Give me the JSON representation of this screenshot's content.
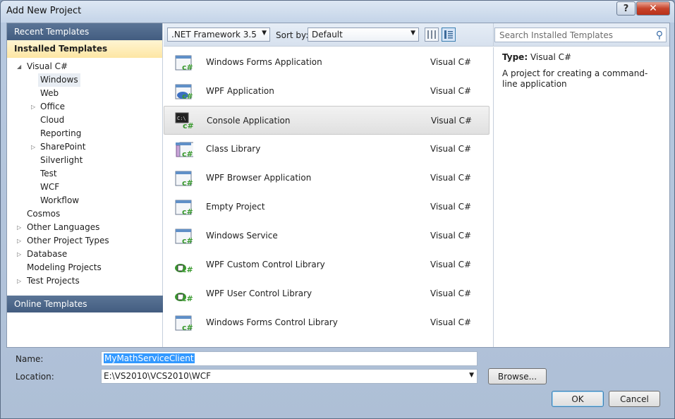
{
  "window": {
    "title": "Add New Project",
    "help": "?",
    "close": "✕"
  },
  "sidebar": {
    "recent": "Recent Templates",
    "installed": "Installed Templates",
    "online": "Online Templates",
    "tree": [
      {
        "label": "Visual C#",
        "arrow": "◢"
      },
      {
        "label": "Windows"
      },
      {
        "label": "Web"
      },
      {
        "label": "Office",
        "arrow": "▷"
      },
      {
        "label": "Cloud"
      },
      {
        "label": "Reporting"
      },
      {
        "label": "SharePoint",
        "arrow": "▷"
      },
      {
        "label": "Silverlight"
      },
      {
        "label": "Test"
      },
      {
        "label": "WCF"
      },
      {
        "label": "Workflow"
      },
      {
        "label": "Cosmos"
      },
      {
        "label": "Other Languages",
        "arrow": "▷"
      },
      {
        "label": "Other Project Types",
        "arrow": "▷"
      },
      {
        "label": "Database",
        "arrow": "▷"
      },
      {
        "label": "Modeling Projects"
      },
      {
        "label": "Test Projects",
        "arrow": "▷"
      }
    ]
  },
  "toolbar": {
    "framework": ".NET Framework 3.5",
    "sort_label": "Sort by:",
    "sort_value": "Default"
  },
  "search": {
    "placeholder": "Search Installed Templates"
  },
  "templates": [
    {
      "name": "Windows Forms Application",
      "lang": "Visual C#",
      "icon": "winforms-app-icon"
    },
    {
      "name": "WPF Application",
      "lang": "Visual C#",
      "icon": "wpf-app-icon"
    },
    {
      "name": "Console Application",
      "lang": "Visual C#",
      "icon": "console-app-icon"
    },
    {
      "name": "Class Library",
      "lang": "Visual C#",
      "icon": "class-library-icon"
    },
    {
      "name": "WPF Browser Application",
      "lang": "Visual C#",
      "icon": "wpf-browser-app-icon"
    },
    {
      "name": "Empty Project",
      "lang": "Visual C#",
      "icon": "empty-project-icon"
    },
    {
      "name": "Windows Service",
      "lang": "Visual C#",
      "icon": "windows-service-icon"
    },
    {
      "name": "WPF Custom Control Library",
      "lang": "Visual C#",
      "icon": "wpf-custom-control-icon"
    },
    {
      "name": "WPF User Control Library",
      "lang": "Visual C#",
      "icon": "wpf-user-control-icon"
    },
    {
      "name": "Windows Forms Control Library",
      "lang": "Visual C#",
      "icon": "winforms-control-icon"
    }
  ],
  "details": {
    "type_key": "Type:",
    "type_value": "Visual C#",
    "description": "A project for creating a command-line application"
  },
  "form": {
    "name_label": "Name:",
    "name_value": "MyMathServiceClient",
    "location_label": "Location:",
    "location_value": "E:\\VS2010\\VCS2010\\WCF",
    "browse": "Browse...",
    "ok": "OK",
    "cancel": "Cancel"
  },
  "colors": {
    "header": "#4f6a8f",
    "accent_green": "#3a9a2f",
    "selection": "#3399ff"
  }
}
